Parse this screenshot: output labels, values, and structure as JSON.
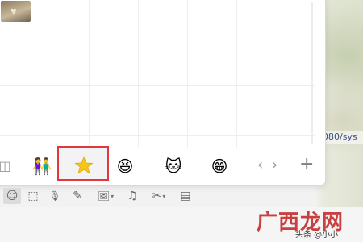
{
  "emoji_panel": {
    "tabs": [
      {
        "name": "couple-sticker",
        "glyph": "👫"
      },
      {
        "name": "favorites-star",
        "glyph": "★",
        "selected": true
      },
      {
        "name": "laughing-sticker",
        "glyph": "😆"
      },
      {
        "name": "cat-sticker",
        "glyph": "🐱"
      },
      {
        "name": "grin-sticker",
        "glyph": "😁"
      }
    ],
    "nav": {
      "prev": "‹",
      "next": "›",
      "add": "+"
    },
    "selected_tab_border_color": "#e1393b",
    "star_color": "#f5c518"
  },
  "toolbar": {
    "tools": [
      {
        "name": "emoji-icon",
        "glyph": "☺"
      },
      {
        "name": "screenshot-icon",
        "glyph": "⬚"
      },
      {
        "name": "microphone-icon",
        "glyph": "🎙"
      },
      {
        "name": "pen-icon",
        "glyph": "✎"
      },
      {
        "name": "image-icon",
        "glyph": "🖼"
      },
      {
        "name": "music-icon",
        "glyph": "♫"
      },
      {
        "name": "scissors-icon",
        "glyph": "✂"
      },
      {
        "name": "archive-icon",
        "glyph": "▤"
      }
    ]
  },
  "background": {
    "url_fragment": "080/sys"
  },
  "watermark": {
    "brand": "广西龙网",
    "small_text": "头条 @小小"
  }
}
